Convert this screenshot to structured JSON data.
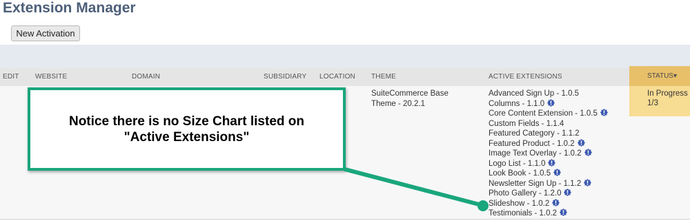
{
  "header": {
    "title": "Extension Manager",
    "new_activation_label": "New Activation"
  },
  "table": {
    "columns": [
      "EDIT",
      "WEBSITE",
      "DOMAIN",
      "SUBSIDIARY",
      "LOCATION",
      "THEME",
      "ACTIVE EXTENSIONS",
      "STATUS▾"
    ],
    "rows": [
      {
        "theme": "SuiteCommerce Base Theme - 20.2.1",
        "status": "In Progress 1/3",
        "extensions": [
          {
            "label": "Advanced Sign Up - 1.0.5",
            "icon": false
          },
          {
            "label": "Columns - 1.1.0",
            "icon": true
          },
          {
            "label": "Core Content Extension - 1.0.5",
            "icon": true
          },
          {
            "label": "Custom Fields - 1.1.4",
            "icon": false
          },
          {
            "label": "Featured Category - 1.1.2",
            "icon": false
          },
          {
            "label": "Featured Product - 1.0.2",
            "icon": true
          },
          {
            "label": "Image Text Overlay - 1.0.2",
            "icon": true
          },
          {
            "label": "Logo List - 1.1.0",
            "icon": true
          },
          {
            "label": "Look Book - 1.0.5",
            "icon": true
          },
          {
            "label": "Newsletter Sign Up - 1.1.2",
            "icon": true
          },
          {
            "label": "Photo Gallery - 1.2.0",
            "icon": true
          },
          {
            "label": "Slideshow - 1.0.2",
            "icon": true
          },
          {
            "label": "Testimonials - 1.0.2",
            "icon": true
          }
        ]
      }
    ]
  },
  "annotation": {
    "text_line1": "Notice there is no Size Chart listed on",
    "text_line2": "\"Active Extensions\""
  },
  "colors": {
    "title": "#4d5f79",
    "status_header": "#e8c06a",
    "status_cell": "#f7dc93",
    "callout_border": "#1aa67c",
    "info_icon": "#3a58b0"
  },
  "icons": {
    "extension_info": "info-badge-icon"
  }
}
